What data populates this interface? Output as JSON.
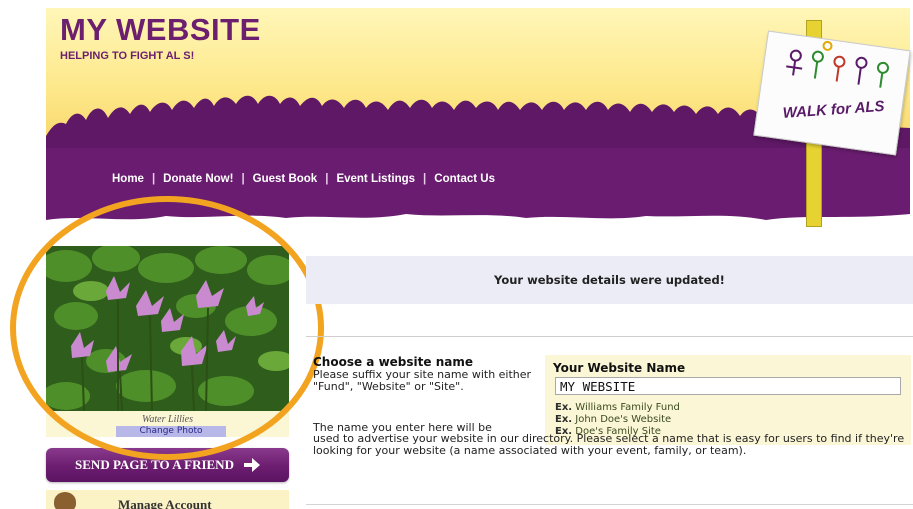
{
  "header": {
    "title": "MY WEBSITE",
    "tagline": "HELPING TO FIGHT AL S!",
    "sign_text": "WALK for ALS",
    "colors": {
      "brand_purple": "#6b1f6e",
      "header_yellow": "#fde88a",
      "ring_orange": "#f2a320"
    }
  },
  "nav": {
    "items": [
      {
        "label": "Home"
      },
      {
        "label": "Donate Now!"
      },
      {
        "label": "Guest Book"
      },
      {
        "label": "Event Listings"
      },
      {
        "label": "Contact Us"
      }
    ],
    "separator": "|"
  },
  "sidebar": {
    "photo_alt": "Water Lillies",
    "caption": "Water Lillies",
    "caption_link": "Change Photo",
    "send_button": "SEND PAGE TO A FRIEND",
    "send_icon": "arrow-right-icon",
    "manage_label": "Manage Account",
    "manage_icon": "teddy-bear-icon"
  },
  "main": {
    "notice": "Your website details were updated!",
    "choose_title": "Choose a website name",
    "choose_desc": "Please suffix your site name with either \"Fund\", \"Website\" or \"Site\".",
    "name_intro": "The name you enter here will be",
    "name_desc": "used to advertise your website in our directory. Please select a name that is easy for users to find if they're looking for your website (a name associated with your event, family, or team).",
    "panel": {
      "title": "Your Website Name",
      "value": "MY WEBSITE",
      "examples": [
        {
          "prefix": "Ex.",
          "text": "Williams Family Fund"
        },
        {
          "prefix": "Ex.",
          "text": "John Doe's Website"
        },
        {
          "prefix": "Ex.",
          "text": "Doe's Family Site"
        }
      ]
    }
  }
}
